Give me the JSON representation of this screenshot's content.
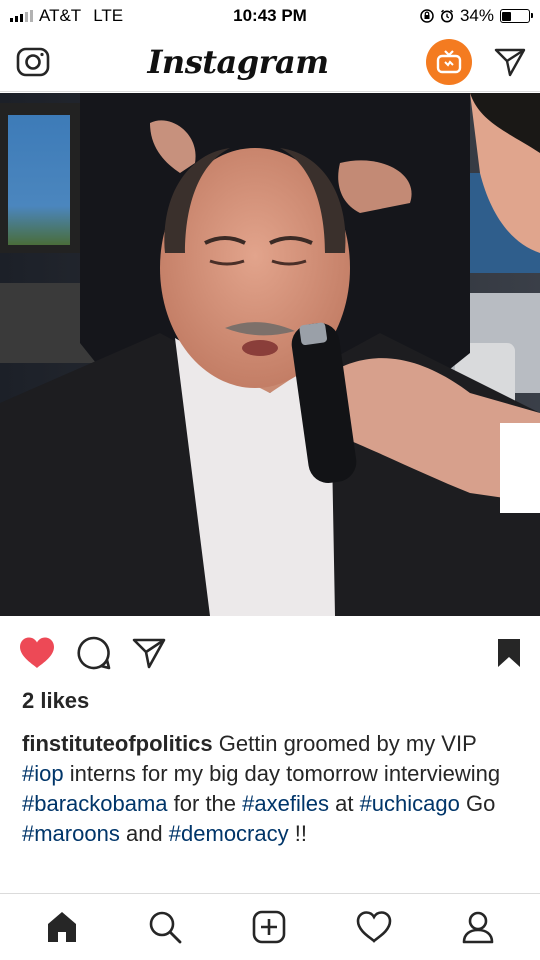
{
  "status_bar": {
    "carrier": "AT&T",
    "network": "LTE",
    "time": "10:43 PM",
    "battery": "34%",
    "battery_level": 0.34
  },
  "header": {
    "logo": "Instagram",
    "icons": [
      "camera-icon",
      "igtv-icon",
      "direct-message-icon"
    ]
  },
  "post": {
    "image_icon": "photo",
    "liked": true,
    "likes": "2 likes",
    "caption": {
      "username": "finstituteofpolitics",
      "text_1": " Gettin groomed by my VIP ",
      "tag_1": "#iop",
      "text_2": " interns for my big day tomorrow interviewing ",
      "tag_2": "#barackobama",
      "text_3": " for the ",
      "tag_3": "#axefiles",
      "text_4": " at ",
      "tag_4": "#uchicago",
      "text_5": " Go ",
      "tag_5": "#maroons",
      "text_6": " and ",
      "tag_6": "#democracy",
      "text_7": " !!"
    }
  },
  "colors": {
    "like_red": "#ed4956",
    "hashtag_blue": "#003569",
    "igtv_orange": "#f47b20"
  },
  "tab_bar": {
    "items": [
      "home-icon",
      "search-icon",
      "new-post-icon",
      "activity-icon",
      "profile-icon"
    ]
  }
}
